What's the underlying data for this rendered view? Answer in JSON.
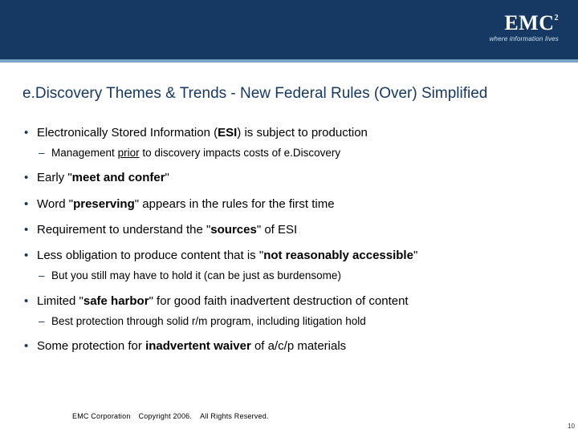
{
  "brand": {
    "logo": "EMC",
    "tagline": "where information lives"
  },
  "title": "e.Discovery Themes & Trends - New Federal Rules (Over) Simplified",
  "bullets": {
    "b1": {
      "pre": "Electronically Stored Information (",
      "bold": "ESI",
      "post": ") is subject to production"
    },
    "s1": {
      "pre": "Management ",
      "u": "prior",
      "post": " to discovery impacts costs of e.Discovery"
    },
    "b2": {
      "pre": "Early \"",
      "bold": "meet and confer",
      "post": "\""
    },
    "b3": {
      "pre": "Word \"",
      "bold": "preserving",
      "post": "\" appears in the rules for the first time"
    },
    "b4": {
      "pre": "Requirement to understand the \"",
      "bold": "sources",
      "post": "\" of ESI"
    },
    "b5": {
      "pre": "Less obligation to produce content that is \"",
      "bold": "not reasonably accessible",
      "post": "\""
    },
    "s5": {
      "text": "But you still may have to hold it (can be just as burdensome)"
    },
    "b6": {
      "pre": "Limited \"",
      "bold": "safe harbor",
      "post": "\" for good faith inadvertent destruction of content"
    },
    "s6": {
      "text": "Best protection through solid r/m program, including litigation hold"
    },
    "b7": {
      "pre": "Some protection for ",
      "bold": "inadvertent waiver",
      "post": " of a/c/p materials"
    }
  },
  "footer": {
    "company": "EMC Corporation",
    "copyright": "Copyright 2006.",
    "rights": "All Rights Reserved."
  },
  "page": "10"
}
